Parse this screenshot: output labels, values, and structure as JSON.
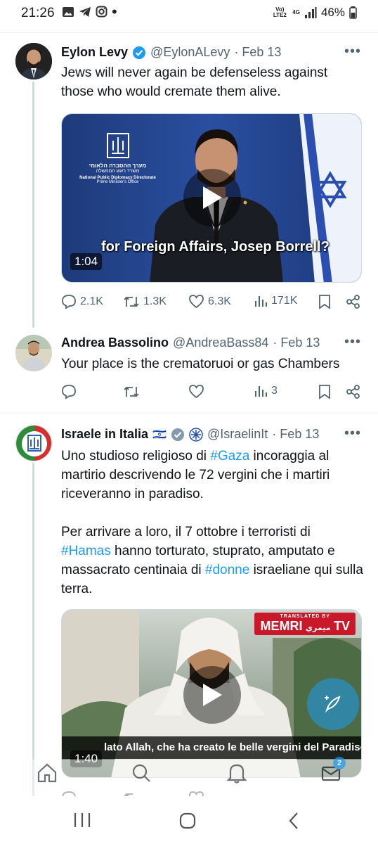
{
  "status_bar": {
    "time": "21:26",
    "network": "Vo) LTE2",
    "net_type": "4G",
    "battery": "46%"
  },
  "tweets": [
    {
      "name": "Eylon Levy",
      "handle": "@EylonALevy",
      "date": "· Feb 13",
      "text": "Jews will never again be defenseless against those who would cremate them alive.",
      "video": {
        "duration": "1:04",
        "caption": "for Foreign Affairs, Josep Borrell?",
        "logo_text_1": "מערך ההסברה הלאומי",
        "logo_text_2": "משרד ראש הממשלה",
        "logo_text_3": "National Public Diplomacy Directorate",
        "logo_text_4": "Prime Minister's Office"
      },
      "stats": {
        "replies": "2.1K",
        "reposts": "1.3K",
        "likes": "6.3K",
        "views": "171K"
      }
    },
    {
      "name": "Andrea Bassolino",
      "handle": "@AndreaBass84",
      "date": "· Feb 13",
      "text": "Your place is the crematoruoi or gas Chambers",
      "stats": {
        "views": "3"
      }
    },
    {
      "name": "Israele in Italia",
      "flag": "🇮🇱",
      "handle": "@IsraelinIt",
      "date": "· Feb 13",
      "p1_a": "Uno studioso religioso di ",
      "p1_tag": "#Gaza",
      "p1_b": " incoraggia al martirio descrivendo le 72 vergini che i martiri riceveranno in paradiso.",
      "p2_a": "Per arrivare a loro, il 7 ottobre i terroristi di ",
      "p2_tag1": "#Hamas",
      "p2_b": " hanno torturato, stuprato, amputato e massacrato centinaia di ",
      "p2_tag2": "#donne",
      "p2_c": " israeliane qui sulla terra.",
      "video": {
        "duration": "1:40",
        "caption": "lato Allah, che ha creato le belle vergini del Paradiso,",
        "watermark_top": "TRANSLATED BY",
        "watermark": "MEMRI",
        "watermark_ar": "ميمري",
        "watermark_tv": "TV"
      }
    }
  ],
  "bottom_nav_badge": "2"
}
